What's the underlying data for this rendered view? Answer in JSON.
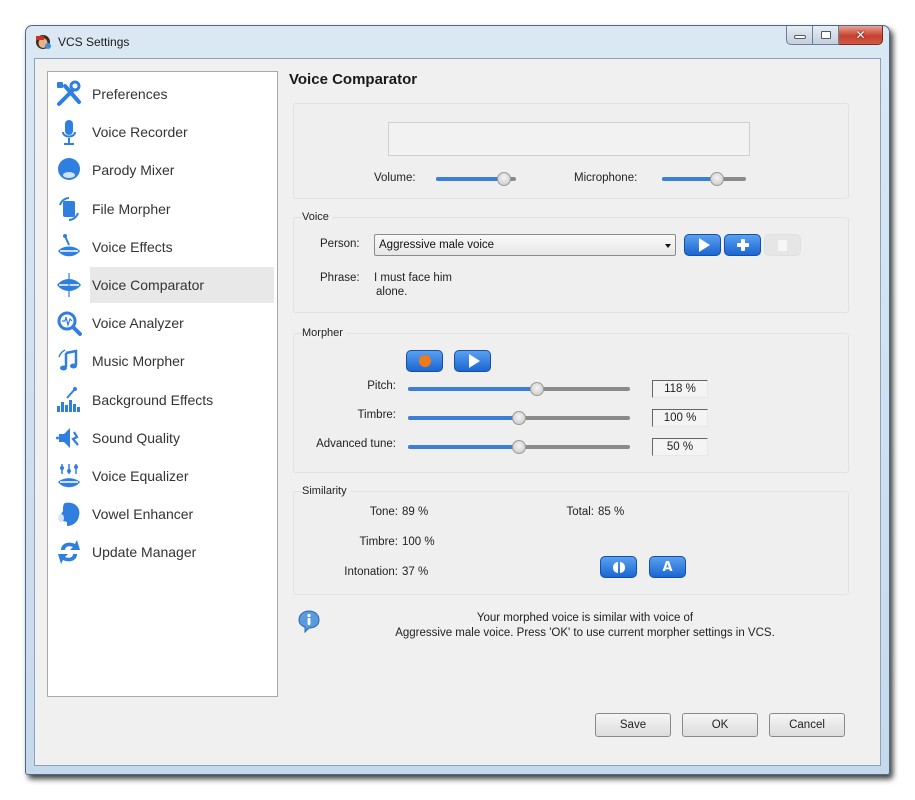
{
  "window": {
    "title": "VCS Settings",
    "controls": {
      "minimize": "minimize",
      "maximize": "maximize",
      "close": "✕"
    }
  },
  "sidebar": {
    "selected_index": 5,
    "items": [
      {
        "label": "Preferences",
        "icon": "tools-icon"
      },
      {
        "label": "Voice Recorder",
        "icon": "microphone-icon"
      },
      {
        "label": "Parody Mixer",
        "icon": "parody-mask-icon"
      },
      {
        "label": "File Morpher",
        "icon": "file-morph-icon"
      },
      {
        "label": "Voice Effects",
        "icon": "lips-wand-icon"
      },
      {
        "label": "Voice Comparator",
        "icon": "lips-compare-icon"
      },
      {
        "label": "Voice Analyzer",
        "icon": "magnifier-wave-icon"
      },
      {
        "label": "Music Morpher",
        "icon": "music-note-icon"
      },
      {
        "label": "Background Effects",
        "icon": "equalizer-wand-icon"
      },
      {
        "label": "Sound Quality",
        "icon": "speaker-icon"
      },
      {
        "label": "Voice Equalizer",
        "icon": "lips-sliders-icon"
      },
      {
        "label": "Vowel Enhancer",
        "icon": "head-profile-icon"
      },
      {
        "label": "Update Manager",
        "icon": "update-arrows-icon"
      }
    ]
  },
  "main": {
    "title": "Voice Comparator",
    "levels": {
      "volume_label": "Volume:",
      "volume_value": 0.85,
      "microphone_label": "Microphone:",
      "microphone_value": 0.65
    },
    "voice": {
      "group_label": "Voice",
      "person_label": "Person:",
      "person_value": "Aggressive male voice",
      "phrase_label": "Phrase:",
      "phrase_line1": "I must face him",
      "phrase_line2": "alone.",
      "buttons": [
        "play",
        "add",
        "delete"
      ]
    },
    "morpher": {
      "group_label": "Morpher",
      "sliders": [
        {
          "label": "Pitch:",
          "display": "118 %",
          "position": 0.58
        },
        {
          "label": "Timbre:",
          "display": "100 %",
          "position": 0.5
        },
        {
          "label": "Advanced tune:",
          "display": "50 %",
          "position": 0.5
        }
      ]
    },
    "similarity": {
      "group_label": "Similarity",
      "tone_label": "Tone:",
      "tone_value": "89 %",
      "timbre_label": "Timbre:",
      "timbre_value": "100 %",
      "intonation_label": "Intonation:",
      "intonation_value": "37 %",
      "total_label": "Total:",
      "total_value": "85 %",
      "auto_button_label": "A"
    },
    "info": {
      "line1": "Your morphed voice is similar with voice of",
      "line2": "Aggressive male voice. Press 'OK' to use current morpher settings in VCS."
    }
  },
  "footer": {
    "save_label": "Save",
    "ok_label": "OK",
    "cancel_label": "Cancel"
  },
  "colors": {
    "accent_blue": "#1b66d2",
    "record_orange": "#f07a1a",
    "close_red": "#c7412d"
  }
}
